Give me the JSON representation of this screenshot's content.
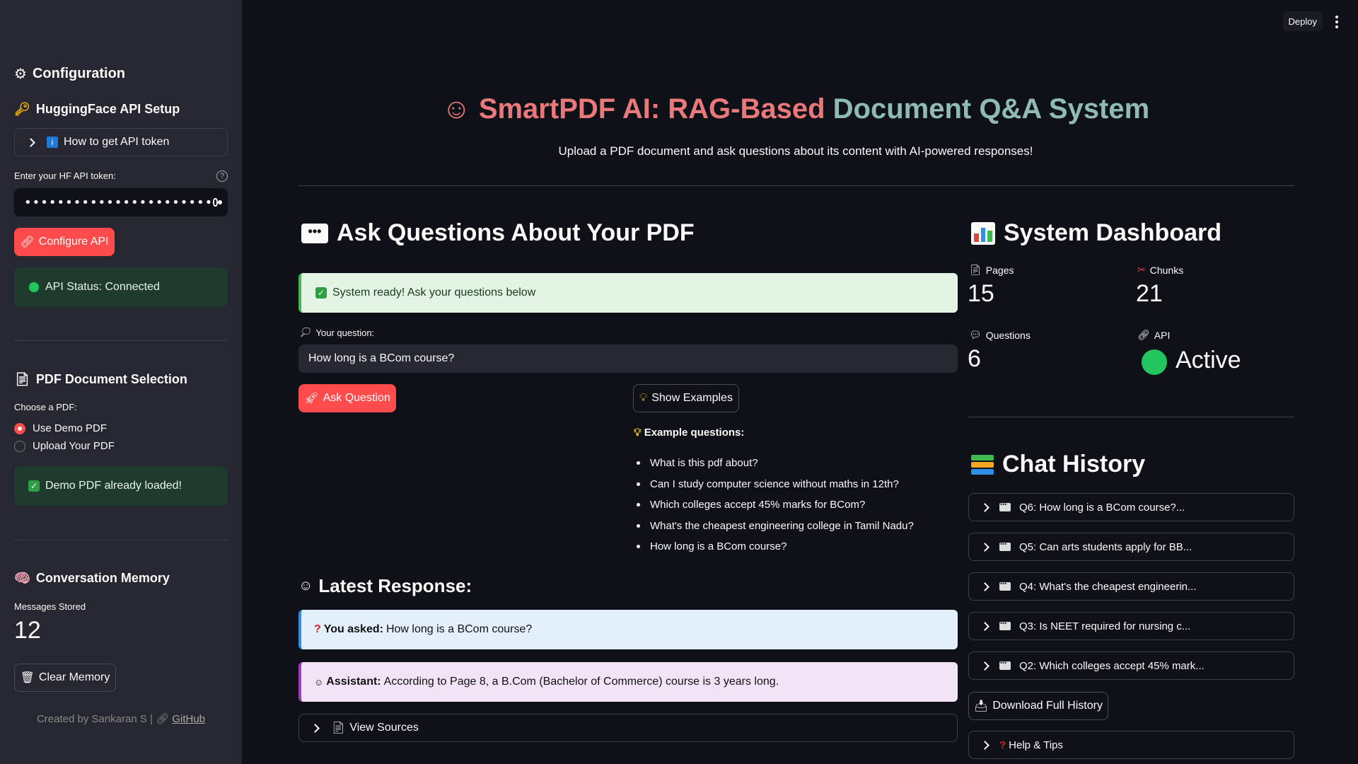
{
  "sidebar": {
    "config_title": "Configuration",
    "hf_title": "HuggingFace API Setup",
    "token_expander": "How to get API token",
    "token_label": "Enter your HF API token:",
    "token_value": "•••••••••••••••••••••••",
    "configure_btn": "Configure API",
    "api_status": "API Status: Connected",
    "pdf_title": "PDF Document Selection",
    "choose_label": "Choose a PDF:",
    "radio_options": [
      "Use Demo PDF",
      "Upload Your PDF"
    ],
    "radio_selected": "Use Demo PDF",
    "demo_loaded": "Demo PDF already loaded!",
    "memory_title": "Conversation Memory",
    "messages_label": "Messages Stored",
    "messages_value": "12",
    "clear_btn": "Clear Memory",
    "footer_text": "Created by Sankaran S |",
    "footer_link": "GitHub"
  },
  "header": {
    "deploy": "Deploy"
  },
  "main": {
    "title_part1": "SmartPDF AI: RAG-Based ",
    "title_part2": "Document Q&A System",
    "subtitle": "Upload a PDF document and ask questions about its content with AI-powered responses!",
    "ask_title": "Ask Questions About Your PDF",
    "ready_msg": "System ready! Ask your questions below",
    "question_label": "Your question:",
    "question_value": "How long is a BCom course?",
    "ask_btn": "Ask Question",
    "examples_btn": "Show Examples",
    "examples_title": "Example questions:",
    "examples": [
      "What is this pdf about?",
      "Can I study computer science without maths in 12th?",
      "Which colleges accept 45% marks for BCom?",
      "What's the cheapest engineering college in Tamil Nadu?",
      "How long is a BCom course?"
    ],
    "latest_title": "Latest Response:",
    "you_asked_label": "You asked:",
    "you_asked_text": "How long is a BCom course?",
    "assistant_label": "Assistant:",
    "assistant_text": "According to Page 8, a B.Com (Bachelor of Commerce) course is 3 years long.",
    "view_sources": "View Sources"
  },
  "dashboard": {
    "title": "System Dashboard",
    "pages_label": "Pages",
    "pages_value": "15",
    "chunks_label": "Chunks",
    "chunks_value": "21",
    "questions_label": "Questions",
    "questions_value": "6",
    "api_label": "API",
    "api_value": "Active"
  },
  "history": {
    "title": "Chat History",
    "items": [
      "Q6: How long is a BCom course?...",
      "Q5: Can arts students apply for BB...",
      "Q4: What's the cheapest engineerin...",
      "Q3: Is NEET required for nursing c...",
      "Q2: Which colleges accept 45% mark..."
    ],
    "download_btn": "Download Full History",
    "help": "Help & Tips"
  },
  "colors": {
    "primary": "#ff4b4b",
    "background": "#0e1117",
    "sidebar": "#262730",
    "success_bg": "#1f3b2d"
  }
}
